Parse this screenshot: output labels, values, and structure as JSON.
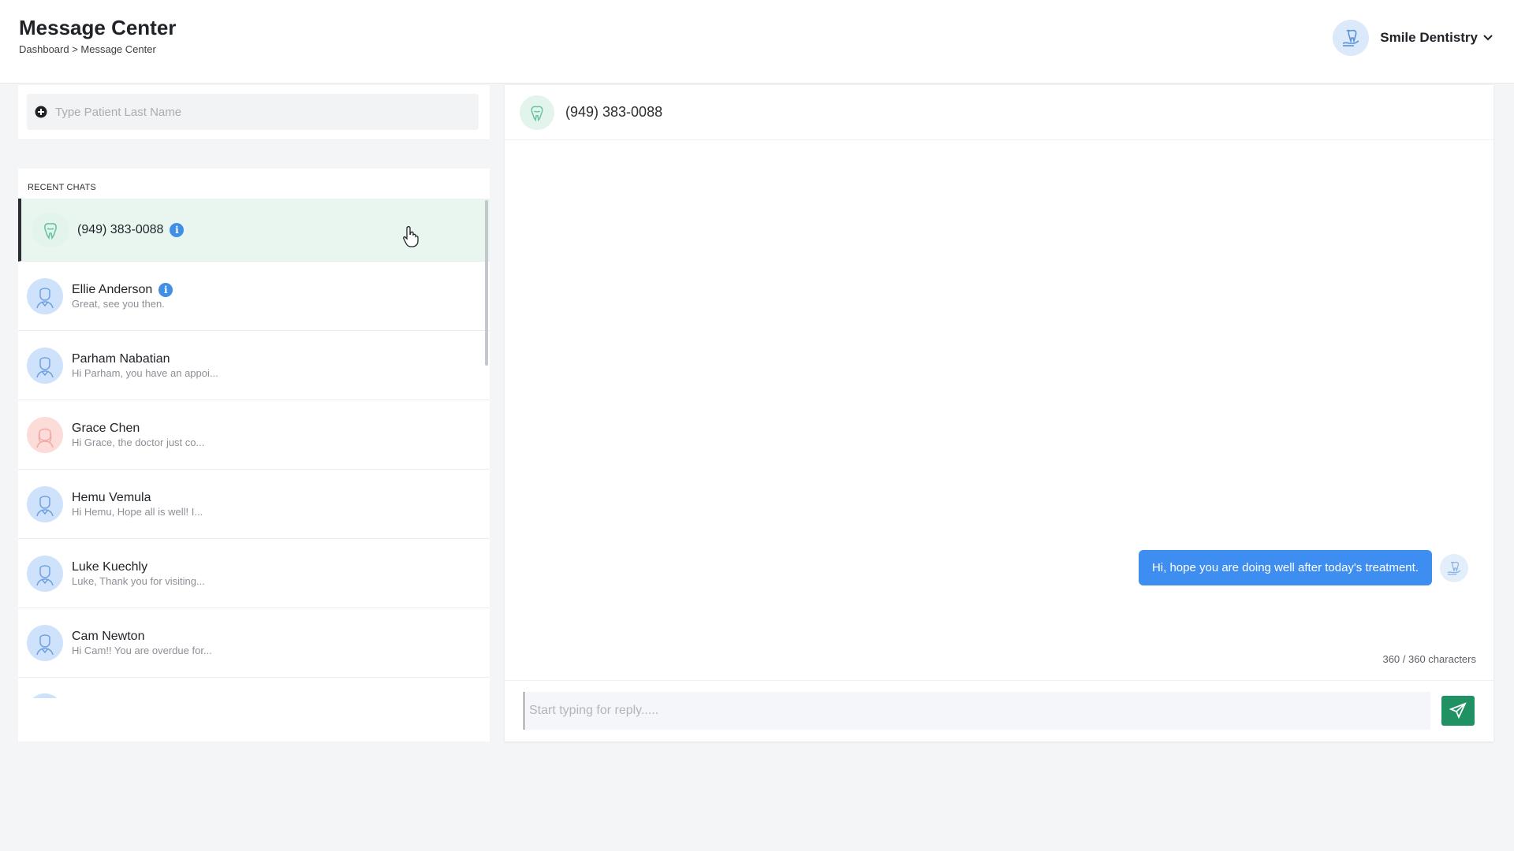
{
  "header": {
    "title": "Message Center",
    "breadcrumb": "Dashboard > Message Center",
    "org_name": "Smile Dentistry"
  },
  "search": {
    "placeholder": "Type Patient Last Name",
    "value": ""
  },
  "recent_chats": {
    "title": "RECENT CHATS",
    "items": [
      {
        "name": "(949) 383-0088",
        "preview": "",
        "avatar": "tooth-icon",
        "info": true,
        "active": true
      },
      {
        "name": "Ellie Anderson",
        "preview": "Great, see you then.",
        "avatar": "patient-icon",
        "info": true,
        "active": false
      },
      {
        "name": "Parham Nabatian",
        "preview": "Hi Parham, you have an appoi...",
        "avatar": "patient-icon",
        "info": false,
        "active": false
      },
      {
        "name": "Grace Chen",
        "preview": "Hi Grace, the doctor just co...",
        "avatar": "patient-icon",
        "info": false,
        "active": false
      },
      {
        "name": "Hemu Vemula",
        "preview": "Hi Hemu, Hope all is well! I...",
        "avatar": "patient-icon",
        "info": false,
        "active": false
      },
      {
        "name": "Luke Kuechly",
        "preview": "Luke, Thank you for visiting...",
        "avatar": "patient-icon",
        "info": false,
        "active": false
      },
      {
        "name": "Cam Newton",
        "preview": "Hi Cam!! You are overdue for...",
        "avatar": "patient-icon",
        "info": false,
        "active": false
      }
    ]
  },
  "conversation": {
    "title": "(949) 383-0088",
    "messages": [
      {
        "text": "Hi, hope you are doing well after today's treatment.",
        "from": "office"
      }
    ],
    "char_count": "360 / 360 characters",
    "reply_placeholder": "Start typing for reply.....",
    "reply_value": ""
  },
  "colors": {
    "accent_blue": "#3d8ef0",
    "send_green": "#1f9163",
    "active_row": "#e9f6ef",
    "info_blue": "#3f8fe6"
  }
}
